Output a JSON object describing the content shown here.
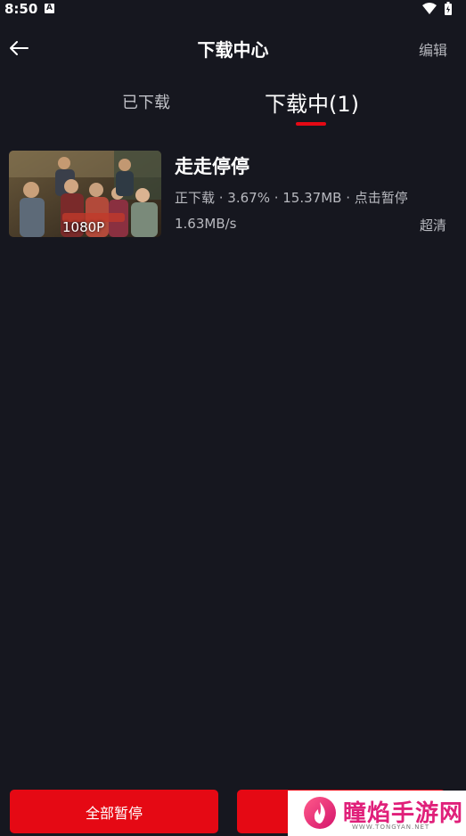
{
  "status_bar": {
    "time": "8:50",
    "notification_icon": "a-box-icon",
    "wifi_icon": "wifi-icon",
    "battery_icon": "battery-icon"
  },
  "header": {
    "back_icon": "arrow-left-icon",
    "title": "下载中心",
    "edit_label": "编辑"
  },
  "tabs": {
    "downloaded_label": "已下载",
    "downloading_label": "下载中(1)",
    "active": "downloading",
    "accent_color": "#e50914"
  },
  "download_item": {
    "title": "走走停停",
    "quality_badge": "1080P",
    "status": "正下载 · 3.67% · 15.37MB · 点击暂停",
    "progress_percent": 3.67,
    "speed": "1.63MB/s",
    "quality": "超清"
  },
  "footer": {
    "pause_all_label": "全部暂停"
  },
  "watermark": {
    "text": "瞳焰手游网",
    "subtext": "WWW.TONGYAN.NET"
  }
}
